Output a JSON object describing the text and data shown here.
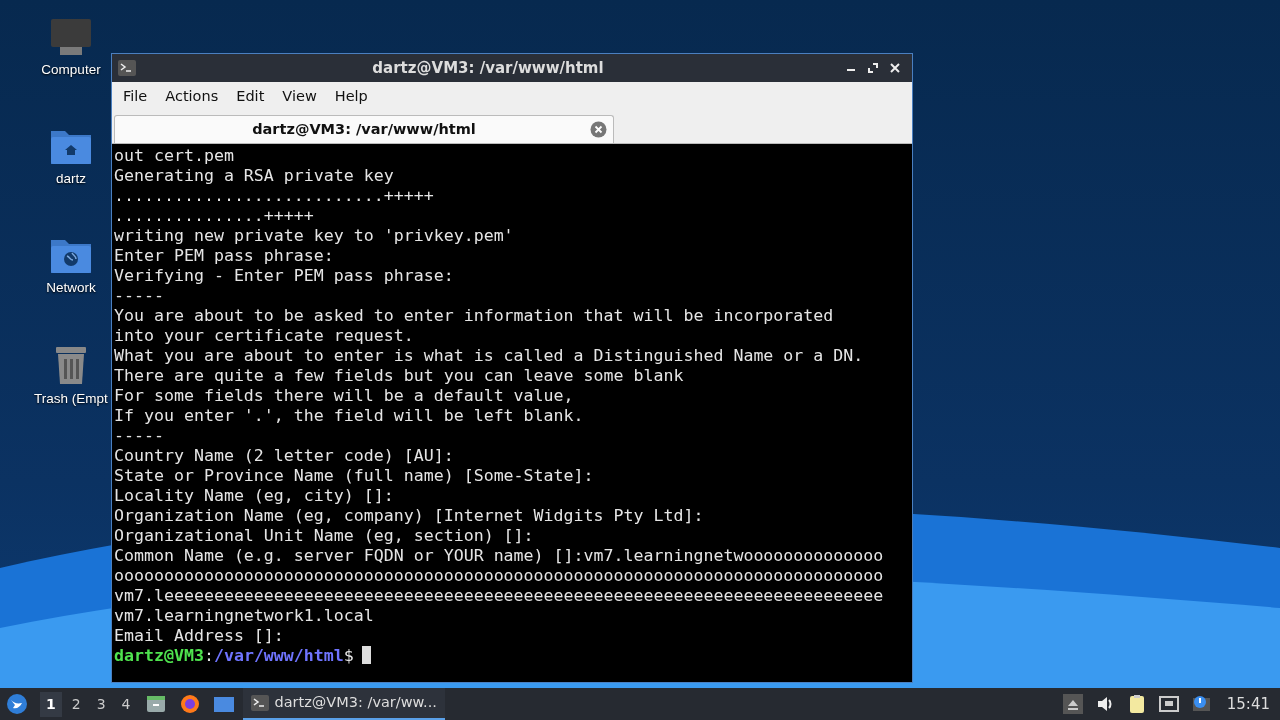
{
  "desktop": {
    "icons": [
      {
        "label": "Computer",
        "kind": "computer"
      },
      {
        "label": "dartz",
        "kind": "home"
      },
      {
        "label": "Network",
        "kind": "network"
      },
      {
        "label": "Trash (Empt",
        "kind": "trash"
      }
    ]
  },
  "window": {
    "title": "dartz@VM3: /var/www/html",
    "menu": [
      "File",
      "Actions",
      "Edit",
      "View",
      "Help"
    ],
    "tabs": [
      {
        "label": "dartz@VM3: /var/www/html",
        "selected": true
      }
    ],
    "terminal": [
      {
        "kind": "output",
        "text": "out cert.pem"
      },
      {
        "kind": "output",
        "text": "Generating a RSA private key"
      },
      {
        "kind": "output",
        "text": "...........................+++++"
      },
      {
        "kind": "output",
        "text": "...............+++++"
      },
      {
        "kind": "output",
        "text": "writing new private key to 'privkey.pem'"
      },
      {
        "kind": "output",
        "text": "Enter PEM pass phrase:"
      },
      {
        "kind": "output",
        "text": "Verifying - Enter PEM pass phrase:"
      },
      {
        "kind": "output",
        "text": "-----"
      },
      {
        "kind": "output",
        "text": "You are about to be asked to enter information that will be incorporated"
      },
      {
        "kind": "output",
        "text": "into your certificate request."
      },
      {
        "kind": "output",
        "text": "What you are about to enter is what is called a Distinguished Name or a DN."
      },
      {
        "kind": "output",
        "text": "There are quite a few fields but you can leave some blank"
      },
      {
        "kind": "output",
        "text": "For some fields there will be a default value,"
      },
      {
        "kind": "output",
        "text": "If you enter '.', the field will be left blank."
      },
      {
        "kind": "output",
        "text": "-----"
      },
      {
        "kind": "output",
        "text": "Country Name (2 letter code) [AU]:"
      },
      {
        "kind": "output",
        "text": "State or Province Name (full name) [Some-State]:"
      },
      {
        "kind": "output",
        "text": "Locality Name (eg, city) []:"
      },
      {
        "kind": "output",
        "text": "Organization Name (eg, company) [Internet Widgits Pty Ltd]:"
      },
      {
        "kind": "output",
        "text": "Organizational Unit Name (eg, section) []:"
      },
      {
        "kind": "output",
        "text": "Common Name (e.g. server FQDN or YOUR name) []:vm7.learningnetwoooooooooooooo"
      },
      {
        "kind": "output",
        "text": "ooooooooooooooooooooooooooooooooooooooooooooooooooooooooooooooooooooooooooooo"
      },
      {
        "kind": "output",
        "text": "vm7.leeeeeeeeeeeeeeeeeeeeeeeeeeeeeeeeeeeeeeeeeeeeeeeeeeeeeeeeeeeeeeeeeeeeeeee"
      },
      {
        "kind": "output",
        "text": "vm7.learningnetwork1.local"
      },
      {
        "kind": "output",
        "text": "Email Address []:"
      },
      {
        "kind": "prompt",
        "user": "dartz@VM3",
        "separator": ":",
        "path": "/var/www/html",
        "symbol": "$"
      }
    ]
  },
  "taskbar": {
    "workspaces": [
      {
        "label": "1",
        "selected": true
      },
      {
        "label": "2",
        "selected": false
      },
      {
        "label": "3",
        "selected": false
      },
      {
        "label": "4",
        "selected": false
      }
    ],
    "tasks": [
      {
        "title": "dartz@VM3: /var/ww...",
        "selected": true
      }
    ],
    "clock": "15:41"
  }
}
